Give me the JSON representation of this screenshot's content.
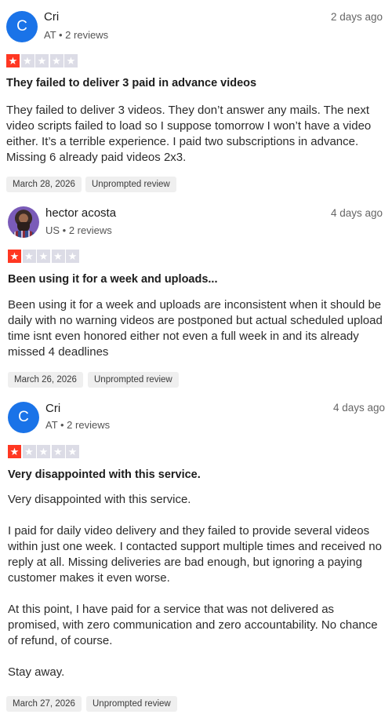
{
  "reviews": [
    {
      "avatar_letter": "C",
      "name": "Cri",
      "meta": "AT • 2 reviews",
      "ago": "2 days ago",
      "rating": 1,
      "title": "They failed to deliver 3 paid in advance videos",
      "body": [
        "They failed to deliver 3 videos. They don’t answer any mails. The next video scripts failed to load so I suppose tomorrow I won’t have a video either. It’s a terrible experience. I paid two subscriptions in advance. Missing 6 already paid videos 2x3."
      ],
      "date": "March 28, 2026",
      "tag": "Unprompted review"
    },
    {
      "name": "hector acosta",
      "meta": "US • 2 reviews",
      "ago": "4 days ago",
      "rating": 1,
      "title": "Been using it for a week and uploads...",
      "body": [
        "Been using it for a week and uploads are inconsistent when it should be daily with no warning videos are postponed but actual scheduled upload time isnt even honored either not even a full week in and its already missed 4 deadlines"
      ],
      "date": "March 26, 2026",
      "tag": "Unprompted review"
    },
    {
      "avatar_letter": "C",
      "name": "Cri",
      "meta": "AT • 2 reviews",
      "ago": "4 days ago",
      "rating": 1,
      "title": "Very disappointed with this service.",
      "body": [
        "Very disappointed with this service.",
        "I paid for daily video delivery and they failed to provide several videos within just one week. I contacted support multiple times and received no reply at all. Missing deliveries are bad enough, but ignoring a paying customer makes it even worse.",
        "At this point, I have paid for a service that was not delivered as promised, with zero communication and zero accountability. No chance of refund, of course.",
        "Stay away."
      ],
      "date": "March 27, 2026",
      "tag": "Unprompted review"
    }
  ],
  "star_icon": "★",
  "colors": {
    "star_on": "#ff3722",
    "star_off": "#dcdce6",
    "avatar_bg": "#1a73e8"
  }
}
